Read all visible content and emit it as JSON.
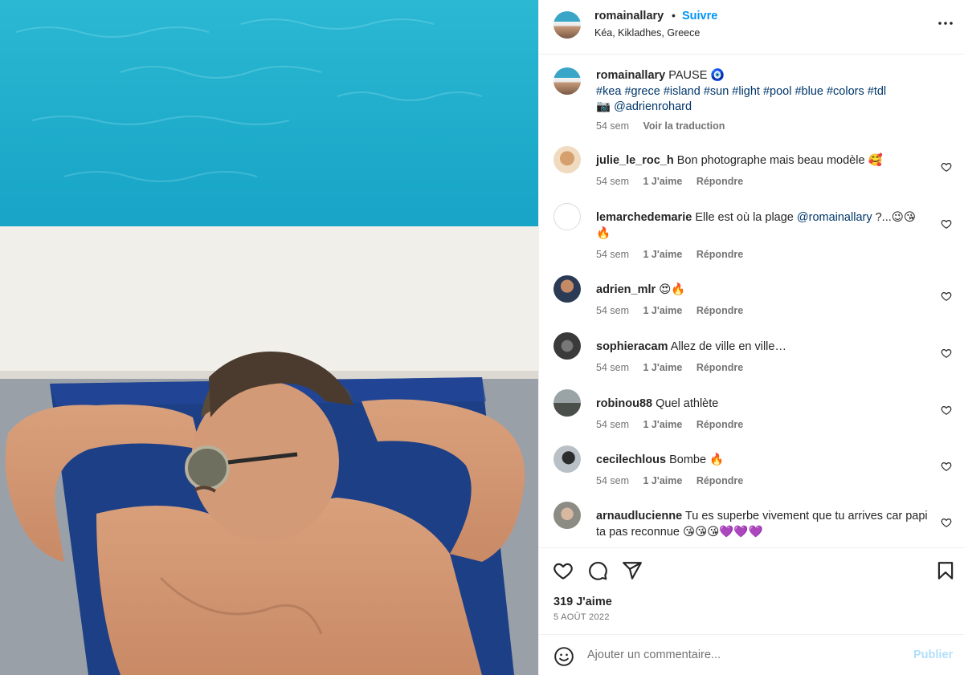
{
  "post": {
    "username": "romainallary",
    "follow_label": "Suivre",
    "location": "Kéa, Kikladhes, Greece",
    "separator": "•",
    "more_icon": "more-horizontal-icon"
  },
  "caption": {
    "username": "romainallary",
    "text": "PAUSE 🧿",
    "hashtags": "#kea #grece #island #sun #light #pool #blue #colors #tdl",
    "credit": "📷 @adrienrohard",
    "time": "54 sem",
    "translate_label": "Voir la traduction"
  },
  "comments": [
    {
      "username": "julie_le_roc_h",
      "text": "Bon photographe mais beau modèle 🥰",
      "time": "54 sem",
      "likes": "1 J'aime",
      "reply": "Répondre"
    },
    {
      "username": "lemarchedemarie",
      "text": "Elle est où la plage",
      "mention": "@romainallary",
      "text_after": " ?...😉😘 🔥",
      "time": "54 sem",
      "likes": "1 J'aime",
      "reply": "Répondre"
    },
    {
      "username": "adrien_mlr",
      "text": "😍🔥",
      "time": "54 sem",
      "likes": "1 J'aime",
      "reply": "Répondre"
    },
    {
      "username": "sophieracam",
      "text": "Allez de ville en ville…",
      "time": "54 sem",
      "likes": "1 J'aime",
      "reply": "Répondre"
    },
    {
      "username": "robinou88",
      "text": "Quel athlète",
      "time": "54 sem",
      "likes": "1 J'aime",
      "reply": "Répondre"
    },
    {
      "username": "cecilechlous",
      "text": "Bombe 🔥",
      "time": "54 sem",
      "likes": "1 J'aime",
      "reply": "Répondre"
    },
    {
      "username": "arnaudlucienne",
      "text": "Tu es superbe vivement que tu arrives car papi ta pas reconnue 😘😘😘💜💜💜",
      "time": "",
      "likes": "",
      "reply": ""
    }
  ],
  "actions": {
    "likes_total": "319 J'aime",
    "date": "5 AOÛT 2022",
    "icons": [
      "heart-icon",
      "comment-icon",
      "share-icon",
      "bookmark-icon"
    ]
  },
  "add_comment": {
    "placeholder": "Ajouter un commentaire...",
    "publish_label": "Publier"
  },
  "colors": {
    "accent": "#0095f6",
    "link": "#00376b",
    "muted": "#737373",
    "publish_disabled": "#b2dffc",
    "pool": "#1fb0cc",
    "towel": "#1d3f86"
  }
}
